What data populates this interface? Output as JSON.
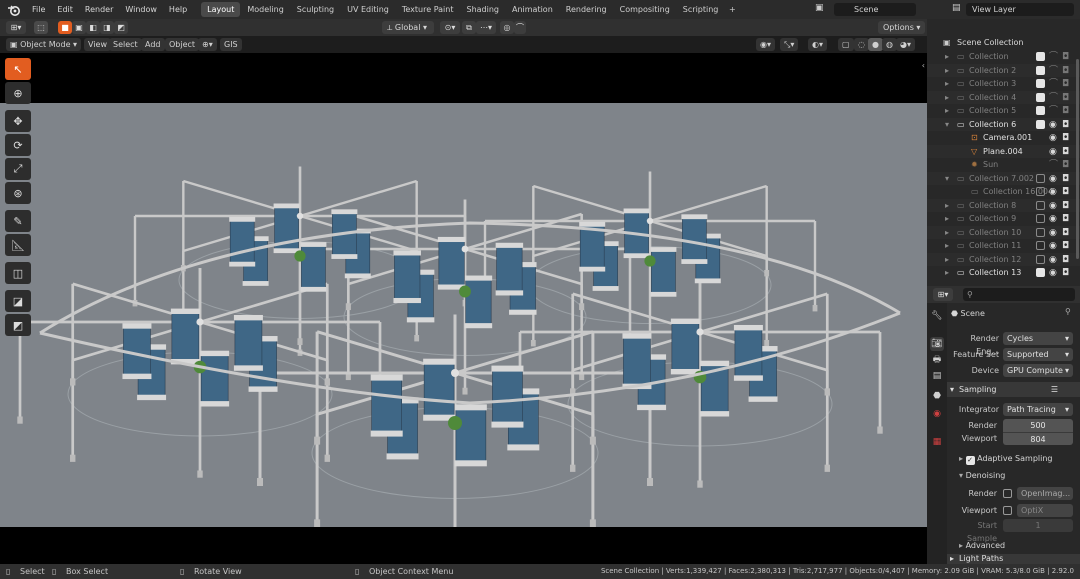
{
  "menu": [
    "File",
    "Edit",
    "Render",
    "Window",
    "Help"
  ],
  "workspaces": [
    {
      "label": "Layout",
      "active": true
    },
    {
      "label": "Modeling"
    },
    {
      "label": "Sculpting"
    },
    {
      "label": "UV Editing"
    },
    {
      "label": "Texture Paint"
    },
    {
      "label": "Shading"
    },
    {
      "label": "Animation"
    },
    {
      "label": "Rendering"
    },
    {
      "label": "Compositing"
    },
    {
      "label": "Scripting"
    }
  ],
  "workspace_add": "+",
  "scene_name": "Scene",
  "view_layer": "View Layer",
  "header": {
    "orientation": "Global",
    "options": "Options"
  },
  "viewport_header": {
    "mode": "Object Mode",
    "menus": [
      "View",
      "Select",
      "Add",
      "Object"
    ],
    "gis": "GIS"
  },
  "outliner": {
    "root": "Scene Collection",
    "rows": [
      {
        "label": "Collection",
        "bright": false,
        "indent": 1,
        "icon": "collection-icon",
        "checked": true,
        "visible": false
      },
      {
        "label": "Collection 2",
        "bright": false,
        "indent": 1,
        "icon": "collection-icon",
        "checked": true,
        "visible": false
      },
      {
        "label": "Collection 3",
        "bright": false,
        "indent": 1,
        "icon": "collection-icon",
        "checked": true,
        "visible": false
      },
      {
        "label": "Collection 4",
        "bright": false,
        "indent": 1,
        "icon": "collection-icon",
        "checked": true,
        "visible": false
      },
      {
        "label": "Collection 5",
        "bright": false,
        "indent": 1,
        "icon": "collection-icon",
        "checked": true,
        "visible": false
      },
      {
        "label": "Collection 6",
        "bright": true,
        "indent": 1,
        "icon": "collection-icon",
        "checked": true,
        "visible": true
      },
      {
        "label": "Camera.001",
        "bright": true,
        "indent": 2,
        "icon": "camera-icon",
        "checked": null,
        "visible": true
      },
      {
        "label": "Plane.004",
        "bright": true,
        "indent": 2,
        "icon": "mesh-icon",
        "checked": null,
        "visible": true
      },
      {
        "label": "Sun",
        "bright": false,
        "indent": 2,
        "icon": "light-icon",
        "checked": null,
        "visible": false
      },
      {
        "label": "Collection 7.002",
        "bright": false,
        "indent": 1,
        "icon": "collection-icon",
        "checked": false,
        "visible": true
      },
      {
        "label": "Collection 16.004",
        "bright": false,
        "indent": 2,
        "icon": "collection-icon",
        "checked": false,
        "visible": true
      },
      {
        "label": "Collection 8",
        "bright": false,
        "indent": 1,
        "icon": "collection-icon",
        "checked": false,
        "visible": true
      },
      {
        "label": "Collection 9",
        "bright": false,
        "indent": 1,
        "icon": "collection-icon",
        "checked": false,
        "visible": true
      },
      {
        "label": "Collection 10",
        "bright": false,
        "indent": 1,
        "icon": "collection-icon",
        "checked": false,
        "visible": true
      },
      {
        "label": "Collection 11",
        "bright": false,
        "indent": 1,
        "icon": "collection-icon",
        "checked": false,
        "visible": true
      },
      {
        "label": "Collection 12",
        "bright": false,
        "indent": 1,
        "icon": "collection-icon",
        "checked": false,
        "visible": true
      },
      {
        "label": "Collection 13",
        "bright": true,
        "indent": 1,
        "icon": "collection-icon",
        "checked": true,
        "visible": true
      }
    ]
  },
  "properties": {
    "breadcrumb": "Scene",
    "render_engine_label": "Render Eng...",
    "render_engine": "Cycles",
    "feature_set_label": "Feature Set",
    "feature_set": "Supported",
    "device_label": "Device",
    "device": "GPU Compute",
    "sampling_section": "Sampling",
    "integrator_label": "Integrator",
    "integrator": "Path Tracing",
    "render_label": "Render",
    "render_samples": "500",
    "viewport_label": "Viewport",
    "viewport_samples": "804",
    "adaptive_sampling": "Adaptive Sampling",
    "denoising": "Denoising",
    "denoise_render_label": "Render",
    "denoise_render": "OpenImag...",
    "denoise_viewport_label": "Viewport",
    "denoise_viewport": "OptiX",
    "start_sample_label": "Start Sample",
    "start_sample": "1",
    "advanced": "Advanced",
    "light_paths": "Light Paths"
  },
  "status": {
    "select": "Select",
    "box_select": "Box Select",
    "rotate_view": "Rotate View",
    "context_menu": "Object Context Menu",
    "stats": "Scene Collection | Verts:1,339,427 | Faces:2,380,313 | Tris:2,717,977 | Objects:0/4,407 | Memory: 2.09 GiB | VRAM: 5.3/8.0 GiB | 2.92.0"
  },
  "colors": {
    "accent": "#e25d20",
    "viewport_bg": "#7f848a",
    "tank": "#3f6786",
    "pipe": "#c9c9c9"
  }
}
